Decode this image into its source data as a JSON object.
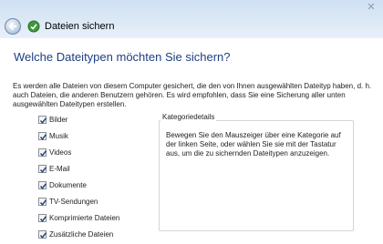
{
  "window": {
    "title": "Dateien sichern",
    "close_glyph": "✕",
    "back_icon": "back-arrow-icon",
    "app_icon": "backup-icon"
  },
  "page": {
    "heading": "Welche Dateitypen möchten Sie sichern?",
    "description": "Es werden alle Dateien von diesem Computer gesichert, die den von Ihnen ausgewählten Dateityp haben, d. h. auch Dateien, die anderen Benutzern gehören. Es wird empfohlen, dass Sie eine Sicherung aller unten ausgewählten Dateitypen erstellen."
  },
  "file_types": [
    {
      "label": "Bilder",
      "checked": true
    },
    {
      "label": "Musik",
      "checked": true
    },
    {
      "label": "Videos",
      "checked": true
    },
    {
      "label": "E-Mail",
      "checked": true
    },
    {
      "label": "Dokumente",
      "checked": true
    },
    {
      "label": "TV-Sendungen",
      "checked": true
    },
    {
      "label": "Komprimierte Dateien",
      "checked": true
    },
    {
      "label": "Zusätzliche Dateien",
      "checked": true
    }
  ],
  "details": {
    "title": "Kategoriedetails",
    "text": "Bewegen Sie den Mauszeiger über eine Kategorie auf der linken Seite, oder wählen Sie sie mit der Tastatur aus, um die zu sichernden Dateitypen anzuzeigen."
  },
  "colors": {
    "heading": "#1e3f80",
    "titlebar": "#d6e5f4",
    "check": "#2c4a86"
  }
}
